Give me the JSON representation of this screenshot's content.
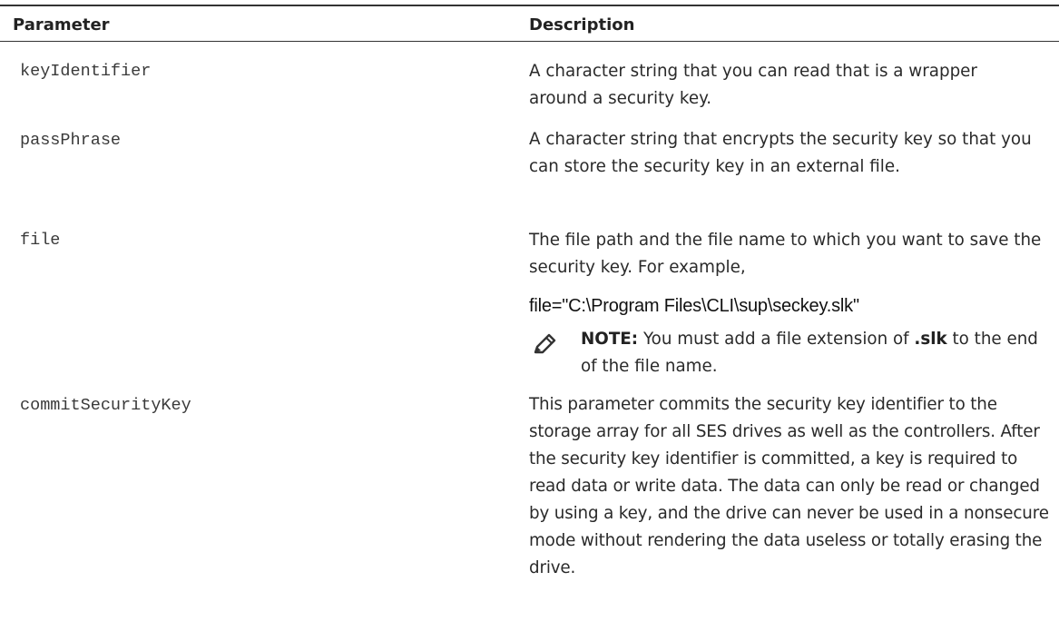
{
  "table": {
    "headers": {
      "parameter": "Parameter",
      "description": "Description"
    },
    "rows": [
      {
        "parameter": "keyIdentifier",
        "description": "A character string that you can read that is a wrapper around a security key."
      },
      {
        "parameter": "passPhrase",
        "description": "A character string that encrypts the security key so that you can store the security key in an external file."
      },
      {
        "parameter": "file",
        "description": "The file path and the file name to which you want to save the security key. For example,",
        "example": "file=\"C:\\Program Files\\CLI\\sup\\seckey.slk\"",
        "note": {
          "label": "NOTE:",
          "text_before": "You must add a file extension of",
          "extension": ".slk",
          "text_after": "to the end of the file name."
        }
      },
      {
        "parameter": "commitSecurityKey",
        "description": "This parameter commits the security key identifier to the storage array for all SES drives as well as the controllers. After the security key identifier is committed, a key is required to read data or write data. The data can only be read or changed by using a key, and the drive can never be used in a nonsecure mode without rendering the data useless or totally erasing the drive."
      }
    ]
  },
  "icons": {
    "note": "pencil-note-icon"
  }
}
